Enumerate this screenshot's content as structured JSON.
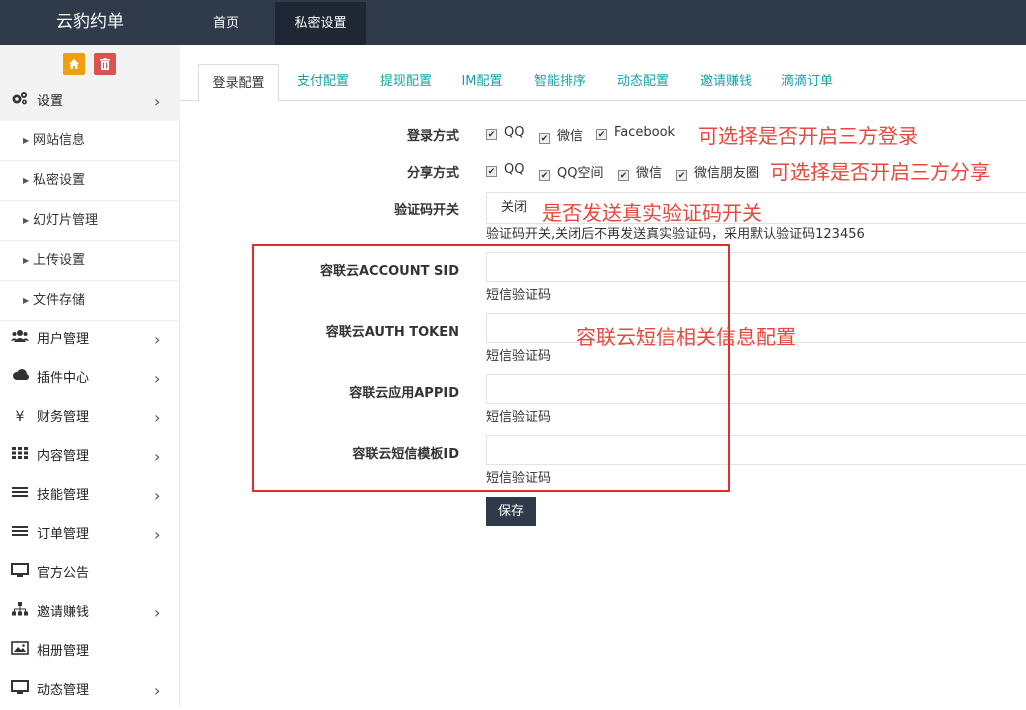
{
  "app": {
    "brand": "云豹约单"
  },
  "topnav": {
    "home": "首页",
    "privacy": "私密设置"
  },
  "sidebar": {
    "menu": [
      {
        "label": "设置",
        "icon": "gears-icon"
      },
      {
        "label": "用户管理",
        "icon": "users-icon"
      },
      {
        "label": "插件中心",
        "icon": "cloud-icon"
      },
      {
        "label": "财务管理",
        "icon": "yen-icon",
        "glyph": "¥"
      },
      {
        "label": "内容管理",
        "icon": "grid-icon"
      },
      {
        "label": "技能管理",
        "icon": "list-icon"
      },
      {
        "label": "订单管理",
        "icon": "list-icon"
      },
      {
        "label": "官方公告",
        "icon": "monitor-icon"
      },
      {
        "label": "邀请赚钱",
        "icon": "sitemap-icon"
      },
      {
        "label": "相册管理",
        "icon": "picture-icon"
      },
      {
        "label": "动态管理",
        "icon": "monitor-icon"
      }
    ],
    "sub": [
      "网站信息",
      "私密设置",
      "幻灯片管理",
      "上传设置",
      "文件存储"
    ]
  },
  "tabs": [
    "登录配置",
    "支付配置",
    "提现配置",
    "IM配置",
    "智能排序",
    "动态配置",
    "邀请赚钱",
    "滴滴订单"
  ],
  "form": {
    "login_label": "登录方式",
    "login_options": [
      "QQ",
      "微信",
      "Facebook"
    ],
    "share_label": "分享方式",
    "share_options": [
      "QQ",
      "QQ空间",
      "微信",
      "微信朋友圈"
    ],
    "captcha_label": "验证码开关",
    "captcha_value": "关闭",
    "captcha_help": "验证码开关,关闭后不再发送真实验证码，采用默认验证码123456",
    "sid_label": "容联云ACCOUNT SID",
    "token_label": "容联云AUTH TOKEN",
    "appid_label": "容联云应用APPID",
    "tpl_label": "容联云短信模板ID",
    "sms_help": "短信验证码",
    "save": "保存"
  },
  "annotations": {
    "login": "可选择是否开启三方登录",
    "share": "可选择是否开启三方分享",
    "captcha": "是否发送真实验证码开关",
    "ronglian": "容联云短信相关信息配置"
  },
  "colors": {
    "topbar": "#2f3a4b",
    "tab_link": "#17a2a8",
    "annotation": "#e8473c",
    "redbox": "#e02e2a"
  }
}
